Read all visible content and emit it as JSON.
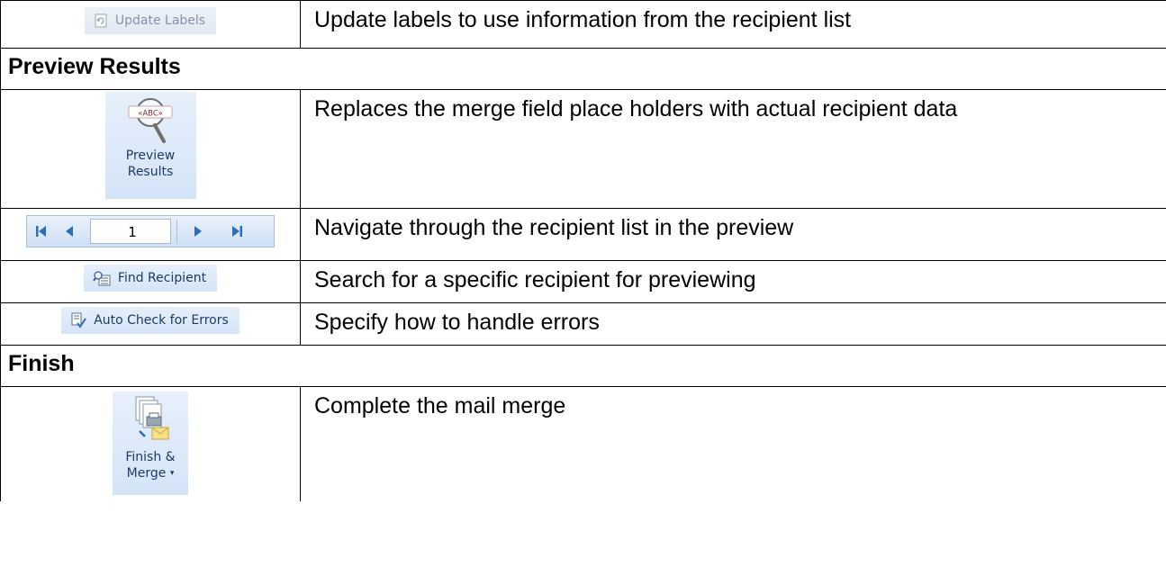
{
  "rows": {
    "update_labels": {
      "button_label": "Update Labels",
      "description": "Update labels to use information from the recipient list"
    },
    "preview_section": "Preview Results",
    "preview_results": {
      "button_line1": "Preview",
      "button_line2": "Results",
      "icon_text": "«ABC»",
      "description": "Replaces the merge field place holders with actual recipient data"
    },
    "navigation": {
      "record_value": "1",
      "description": "Navigate through the recipient list in the preview"
    },
    "find_recipient": {
      "button_label": "Find Recipient",
      "description": "Search for a specific recipient for previewing"
    },
    "auto_check": {
      "button_label": "Auto Check for Errors",
      "description": "Specify how to handle errors"
    },
    "finish_section": "Finish",
    "finish_merge": {
      "button_line1": "Finish &",
      "button_line2": "Merge",
      "description": "Complete the mail merge"
    }
  },
  "colors": {
    "ribbon_blue": "#d4e4f7",
    "ribbon_text": "#1f3a67",
    "nav_arrow": "#2f6db5"
  },
  "icons": [
    "update-labels-icon",
    "magnifier-icon",
    "first-record-icon",
    "previous-record-icon",
    "next-record-icon",
    "last-record-icon",
    "find-recipient-icon",
    "auto-check-icon",
    "finish-merge-icon",
    "dropdown-arrow-icon"
  ]
}
